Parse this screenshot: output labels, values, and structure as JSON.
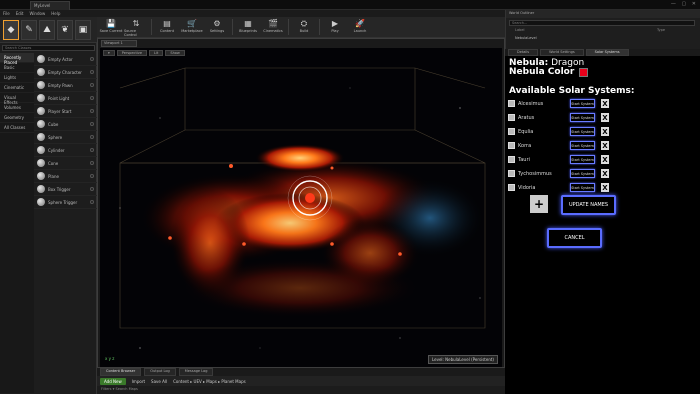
{
  "window": {
    "tab": "MyLevel",
    "controls": "— ▢ ✕"
  },
  "menu": [
    "File",
    "Edit",
    "Window",
    "Help"
  ],
  "modes": [
    {
      "icon": "place-mode-icon",
      "glyph": "◆"
    },
    {
      "icon": "paint-mode-icon",
      "glyph": "✎"
    },
    {
      "icon": "landscape-mode-icon",
      "glyph": "⛰"
    },
    {
      "icon": "foliage-mode-icon",
      "glyph": "❦"
    },
    {
      "icon": "geometry-mode-icon",
      "glyph": "▣"
    }
  ],
  "place": {
    "search_placeholder": "Search Classes",
    "categories": [
      "Recently Placed",
      "Basic",
      "Lights",
      "Cinematic",
      "Visual Effects",
      "Volumes",
      "Geometry",
      "All Classes"
    ],
    "items": [
      "Empty Actor",
      "Empty Character",
      "Empty Pawn",
      "Point Light",
      "Player Start",
      "Cube",
      "Sphere",
      "Cylinder",
      "Cone",
      "Plane",
      "Box Trigger",
      "Sphere Trigger"
    ]
  },
  "toolbar": [
    {
      "label": "Save Current",
      "glyph": "💾",
      "icon": "save-icon"
    },
    {
      "label": "Source Control",
      "glyph": "⇅",
      "icon": "source-control-icon"
    },
    {
      "label": "Content",
      "glyph": "▤",
      "icon": "content-icon"
    },
    {
      "label": "Marketplace",
      "glyph": "🛒",
      "icon": "marketplace-icon"
    },
    {
      "label": "Settings",
      "glyph": "⚙",
      "icon": "settings-icon"
    },
    {
      "label": "Blueprints",
      "glyph": "▦",
      "icon": "blueprints-icon"
    },
    {
      "label": "Cinematics",
      "glyph": "🎬",
      "icon": "cinematics-icon"
    },
    {
      "label": "Build",
      "glyph": "⛭",
      "icon": "build-icon"
    },
    {
      "label": "Play",
      "glyph": "▶",
      "icon": "play-icon"
    },
    {
      "label": "Launch",
      "glyph": "🚀",
      "icon": "launch-icon"
    }
  ],
  "viewport": {
    "tab": "Viewport 1",
    "buttons": [
      "▾",
      "Perspective",
      "Lit",
      "Show"
    ],
    "label": "Level: NebulaLevel (Persistent)",
    "axis": "x y z"
  },
  "content_browser": {
    "tabs": [
      "Content Browser",
      "Output Log",
      "Message Log"
    ],
    "add_new": "Add New",
    "import": "Import",
    "save_all": "Save All",
    "path": "Content ▸ UEV ▸ Maps ▸ Planet Maps",
    "filter": "Filters ▾  Search Maps"
  },
  "outliner": {
    "title": "World Outliner",
    "search_placeholder": "Search...",
    "col_label": "Label",
    "col_type": "Type",
    "row": "NebulaLevel"
  },
  "right_tabs": [
    "Details",
    "World Settings",
    "Solar Systems"
  ],
  "widget": {
    "nebula_label": "Nebula:",
    "nebula_name": "Dragon",
    "color_label": "Nebula Color",
    "color_value": "#e8001a",
    "heading": "Available Solar Systems:",
    "systems": [
      "Alcesimus",
      "Aratus",
      "Equlia",
      "Korra",
      "Tauri",
      "Tychosimmus",
      "Vidoria"
    ],
    "start_button": "Start System",
    "remove_glyph": "X",
    "plus": "+",
    "update": "UPDATE NAMES",
    "cancel": "CANCEL"
  }
}
